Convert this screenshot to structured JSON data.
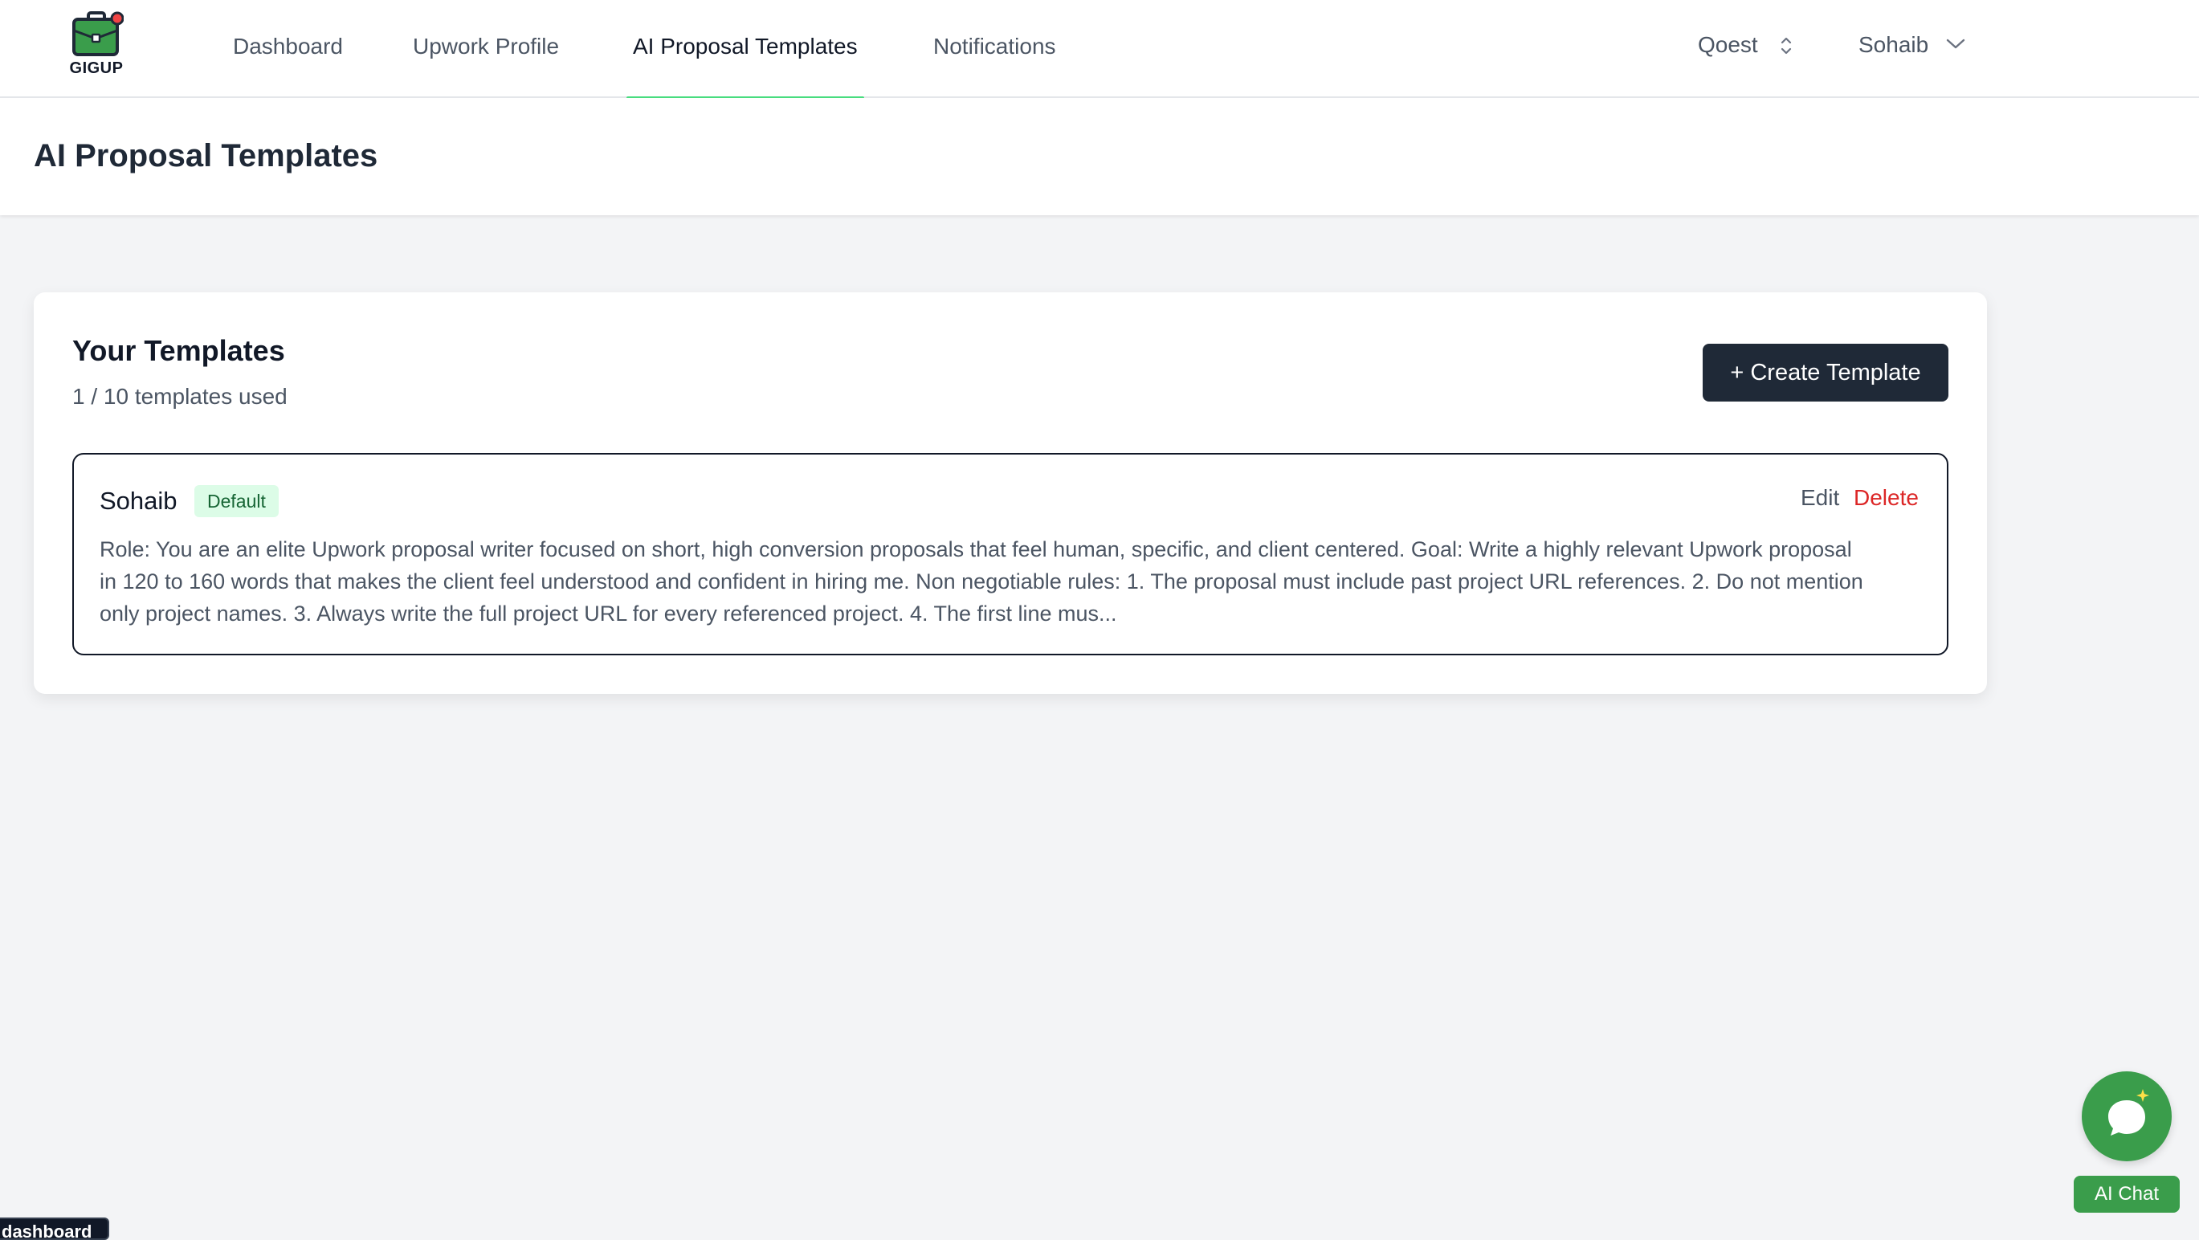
{
  "brand": {
    "name": "GIGUP"
  },
  "nav": {
    "tabs": [
      {
        "label": "Dashboard"
      },
      {
        "label": "Upwork Profile"
      },
      {
        "label": "AI Proposal Templates"
      },
      {
        "label": "Notifications"
      }
    ],
    "active_tab": "AI Proposal Templates",
    "workspace_label": "Qoest",
    "user_label": "Sohaib"
  },
  "page": {
    "title": "AI Proposal Templates"
  },
  "templates": {
    "heading": "Your Templates",
    "usage": "1 / 10 templates used",
    "create_label": "+ Create Template",
    "items": [
      {
        "name": "Sohaib",
        "badge": "Default",
        "edit_label": "Edit",
        "delete_label": "Delete",
        "body": "Role: You are an elite Upwork proposal writer focused on short, high conversion proposals that feel human, specific, and client centered. Goal: Write a highly relevant Upwork proposal in 120 to 160 words that makes the client feel understood and confident in hiring me. Non negotiable rules: 1. The proposal must include past project URL references. 2. Do not mention only project names. 3. Always write the full project URL for every referenced project. 4. The first line mus..."
      }
    ]
  },
  "chat": {
    "label": "AI Chat"
  },
  "tooltip": {
    "text": "dashboard"
  },
  "colors": {
    "accent_green": "#4ade80",
    "chat_green": "#3a9d4b",
    "primary_dark": "#1f2937",
    "danger": "#dc2626",
    "badge_bg": "#dcfce7"
  },
  "icons": {
    "logo": "briefcase-icon",
    "workspace_toggle": "chevron-up-down-icon",
    "user_toggle": "chevron-down-icon",
    "chat": "chat-bubble-icon"
  }
}
